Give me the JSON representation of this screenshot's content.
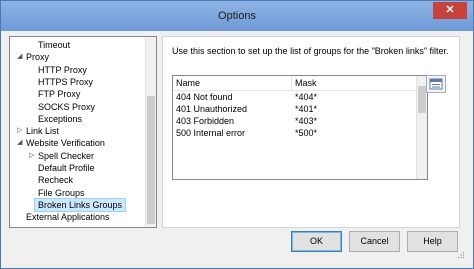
{
  "window": {
    "title": "Options",
    "close_label": "✕"
  },
  "tree": {
    "items": [
      {
        "label": "Timeout",
        "indent": 2,
        "expander": ""
      },
      {
        "label": "Proxy",
        "indent": 1,
        "expander": "◢"
      },
      {
        "label": "HTTP Proxy",
        "indent": 2,
        "expander": ""
      },
      {
        "label": "HTTPS Proxy",
        "indent": 2,
        "expander": ""
      },
      {
        "label": "FTP Proxy",
        "indent": 2,
        "expander": ""
      },
      {
        "label": "SOCKS Proxy",
        "indent": 2,
        "expander": ""
      },
      {
        "label": "Exceptions",
        "indent": 2,
        "expander": ""
      },
      {
        "label": "Link List",
        "indent": 1,
        "expander": "▷"
      },
      {
        "label": "Website Verification",
        "indent": 1,
        "expander": "◢"
      },
      {
        "label": "Spell Checker",
        "indent": 2,
        "expander": "▷"
      },
      {
        "label": "Default Profile",
        "indent": 2,
        "expander": ""
      },
      {
        "label": "Recheck",
        "indent": 2,
        "expander": ""
      },
      {
        "label": "File Groups",
        "indent": 2,
        "expander": ""
      },
      {
        "label": "Broken Links Groups",
        "indent": 2,
        "expander": "",
        "selected": true
      },
      {
        "label": "External Applications",
        "indent": 1,
        "expander": ""
      }
    ]
  },
  "panel": {
    "description": "Use this section to set up the list of groups for the \"Broken links\" filter.",
    "columns": {
      "name": "Name",
      "mask": "Mask"
    },
    "rows": [
      {
        "name": "404 Not found",
        "mask": "*404*"
      },
      {
        "name": "401 Unauthorized",
        "mask": "*401*"
      },
      {
        "name": "403 Forbidden",
        "mask": "*403*"
      },
      {
        "name": "500 Internal error",
        "mask": "*500*"
      }
    ]
  },
  "buttons": {
    "ok": "OK",
    "cancel": "Cancel",
    "help": "Help"
  }
}
